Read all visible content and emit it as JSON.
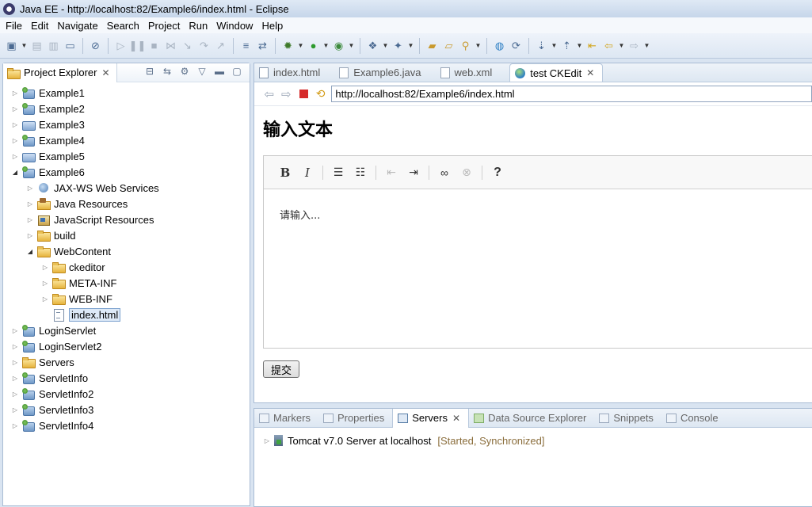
{
  "window": {
    "title": "Java EE - http://localhost:82/Example6/index.html - Eclipse"
  },
  "menu": [
    "File",
    "Edit",
    "Navigate",
    "Search",
    "Project",
    "Run",
    "Window",
    "Help"
  ],
  "explorer": {
    "title": "Project Explorer",
    "tree": [
      {
        "label": "Example1"
      },
      {
        "label": "Example2"
      },
      {
        "label": "Example3"
      },
      {
        "label": "Example4"
      },
      {
        "label": "Example5"
      },
      {
        "label": "Example6"
      },
      {
        "label": "JAX-WS Web Services"
      },
      {
        "label": "Java Resources"
      },
      {
        "label": "JavaScript Resources"
      },
      {
        "label": "build"
      },
      {
        "label": "WebContent"
      },
      {
        "label": "ckeditor"
      },
      {
        "label": "META-INF"
      },
      {
        "label": "WEB-INF"
      },
      {
        "label": "index.html"
      },
      {
        "label": "LoginServlet"
      },
      {
        "label": "LoginServlet2"
      },
      {
        "label": "Servers"
      },
      {
        "label": "ServletInfo"
      },
      {
        "label": "ServletInfo2"
      },
      {
        "label": "ServletInfo3"
      },
      {
        "label": "ServletInfo4"
      }
    ]
  },
  "editor": {
    "tabs": [
      {
        "label": "index.html"
      },
      {
        "label": "Example6.java"
      },
      {
        "label": "web.xml"
      },
      {
        "label": "test CKEdit"
      }
    ],
    "url": "http://localhost:82/Example6/index.html",
    "page": {
      "heading": "输入文本",
      "placeholder": "请输入...",
      "submit": "提交"
    }
  },
  "bottom": {
    "tabs": [
      {
        "label": "Markers"
      },
      {
        "label": "Properties"
      },
      {
        "label": "Servers"
      },
      {
        "label": "Data Source Explorer"
      },
      {
        "label": "Snippets"
      },
      {
        "label": "Console"
      }
    ],
    "server": {
      "name": "Tomcat v7.0 Server at localhost",
      "status": "[Started, Synchronized]"
    }
  }
}
